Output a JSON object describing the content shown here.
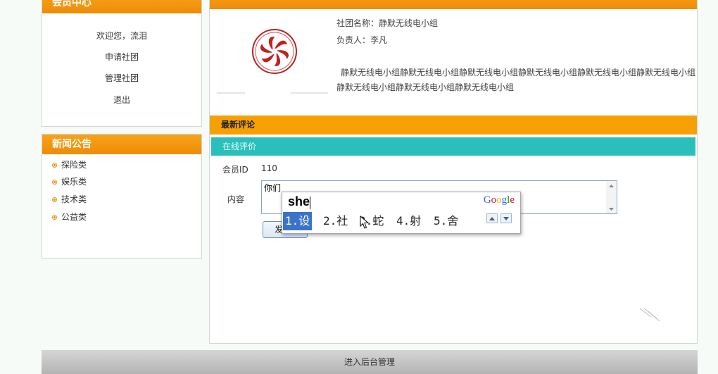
{
  "member_center": {
    "title": "会员中心",
    "items": [
      "欢迎您，流泪",
      "申请社团",
      "管理社团",
      "退出"
    ]
  },
  "news": {
    "title": "新闻公告",
    "items": [
      "探险类",
      "娱乐类",
      "技术类",
      "公益类"
    ]
  },
  "club": {
    "name_line": "社团名称：静默无线电小组",
    "leader_line": "负责人：李凡",
    "description": "静默无线电小组静默无线电小组静默无线电小组静默无线电小组静默无线电小组静默无线电小组静默无线电小组静默无线电小组静默无线电小组"
  },
  "comments": {
    "section_title": "最新评论",
    "review_title": "在线评价",
    "member_id_label": "会员ID",
    "member_id_value": "110",
    "content_label": "内容",
    "content_value": "你们",
    "submit_label": "发"
  },
  "ime": {
    "composition": "she",
    "brand": "Google",
    "candidates": [
      "1.设",
      "2.社",
      "3.蛇",
      "4.射",
      "5.舍"
    ],
    "selected_index": 0,
    "brand_colors": [
      "#3369e8",
      "#d50f25",
      "#eeb211",
      "#3369e8",
      "#009925",
      "#d50f25"
    ]
  },
  "footer": {
    "label": "进入后台管理"
  },
  "colors": {
    "orange": "#f7a004",
    "teal": "#2bbfbb",
    "selection": "#3a74c8"
  }
}
